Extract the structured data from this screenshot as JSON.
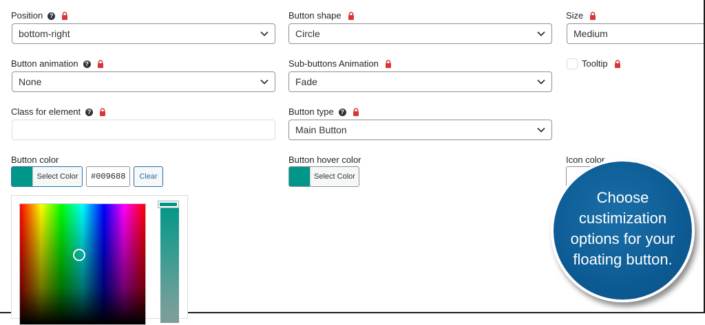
{
  "fields": {
    "position": {
      "label": "Position",
      "value": "bottom-right"
    },
    "button_shape": {
      "label": "Button shape",
      "value": "Circle"
    },
    "size": {
      "label": "Size",
      "value": "Medium"
    },
    "button_animation": {
      "label": "Button animation",
      "value": "None"
    },
    "sub_buttons_animation": {
      "label": "Sub-buttons Animation",
      "value": "Fade"
    },
    "tooltip": {
      "label": "Tooltip",
      "checked": false
    },
    "class_for_element": {
      "label": "Class for element",
      "value": ""
    },
    "button_type": {
      "label": "Button type",
      "value": "Main Button"
    },
    "button_color": {
      "label": "Button color",
      "select_label": "Select Color",
      "hex": "#009688",
      "clear_label": "Clear",
      "swatch": "#009688"
    },
    "button_hover_color": {
      "label": "Button hover color",
      "select_label": "Select Color",
      "swatch": "#009688"
    },
    "icon_color": {
      "label": "Icon color"
    }
  },
  "icons": {
    "help": "question-mark-icon",
    "lock": "lock-icon",
    "dropdown": "chevron-down-icon"
  },
  "help_glyph": "?",
  "callout": {
    "lines": [
      "Choose",
      "custimization",
      "options for your",
      "floating button."
    ]
  },
  "colors": {
    "accent": "#2271b1",
    "swatch": "#009688",
    "lock": "#d63638",
    "callout": "#0d5b94"
  }
}
